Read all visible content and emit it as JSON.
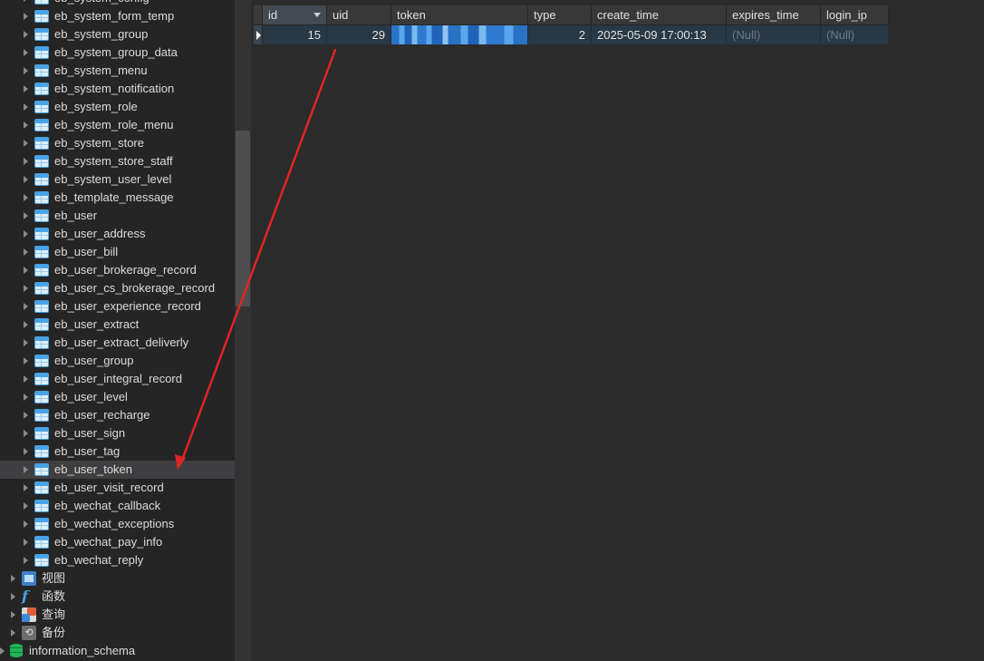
{
  "sidebar": {
    "tables": [
      "eb_system_config",
      "eb_system_form_temp",
      "eb_system_group",
      "eb_system_group_data",
      "eb_system_menu",
      "eb_system_notification",
      "eb_system_role",
      "eb_system_role_menu",
      "eb_system_store",
      "eb_system_store_staff",
      "eb_system_user_level",
      "eb_template_message",
      "eb_user",
      "eb_user_address",
      "eb_user_bill",
      "eb_user_brokerage_record",
      "eb_user_cs_brokerage_record",
      "eb_user_experience_record",
      "eb_user_extract",
      "eb_user_extract_deliverly",
      "eb_user_group",
      "eb_user_integral_record",
      "eb_user_level",
      "eb_user_recharge",
      "eb_user_sign",
      "eb_user_tag",
      "eb_user_token",
      "eb_user_visit_record",
      "eb_wechat_callback",
      "eb_wechat_exceptions",
      "eb_wechat_pay_info",
      "eb_wechat_reply"
    ],
    "selected": "eb_user_token",
    "groups": {
      "views": "视图",
      "functions": "函数",
      "queries": "查询",
      "backups": "备份"
    },
    "database": "information_schema"
  },
  "grid": {
    "columns": [
      "id",
      "uid",
      "token",
      "type",
      "create_time",
      "expires_time",
      "login_ip"
    ],
    "sorted_column": "id",
    "rows": [
      {
        "id": "15",
        "uid": "29",
        "token": "",
        "type": "2",
        "create_time": "2025-05-09 17:00:13",
        "expires_time": "(Null)",
        "login_ip": "(Null)"
      }
    ]
  },
  "annotation": {
    "arrow_color": "#e02424"
  }
}
